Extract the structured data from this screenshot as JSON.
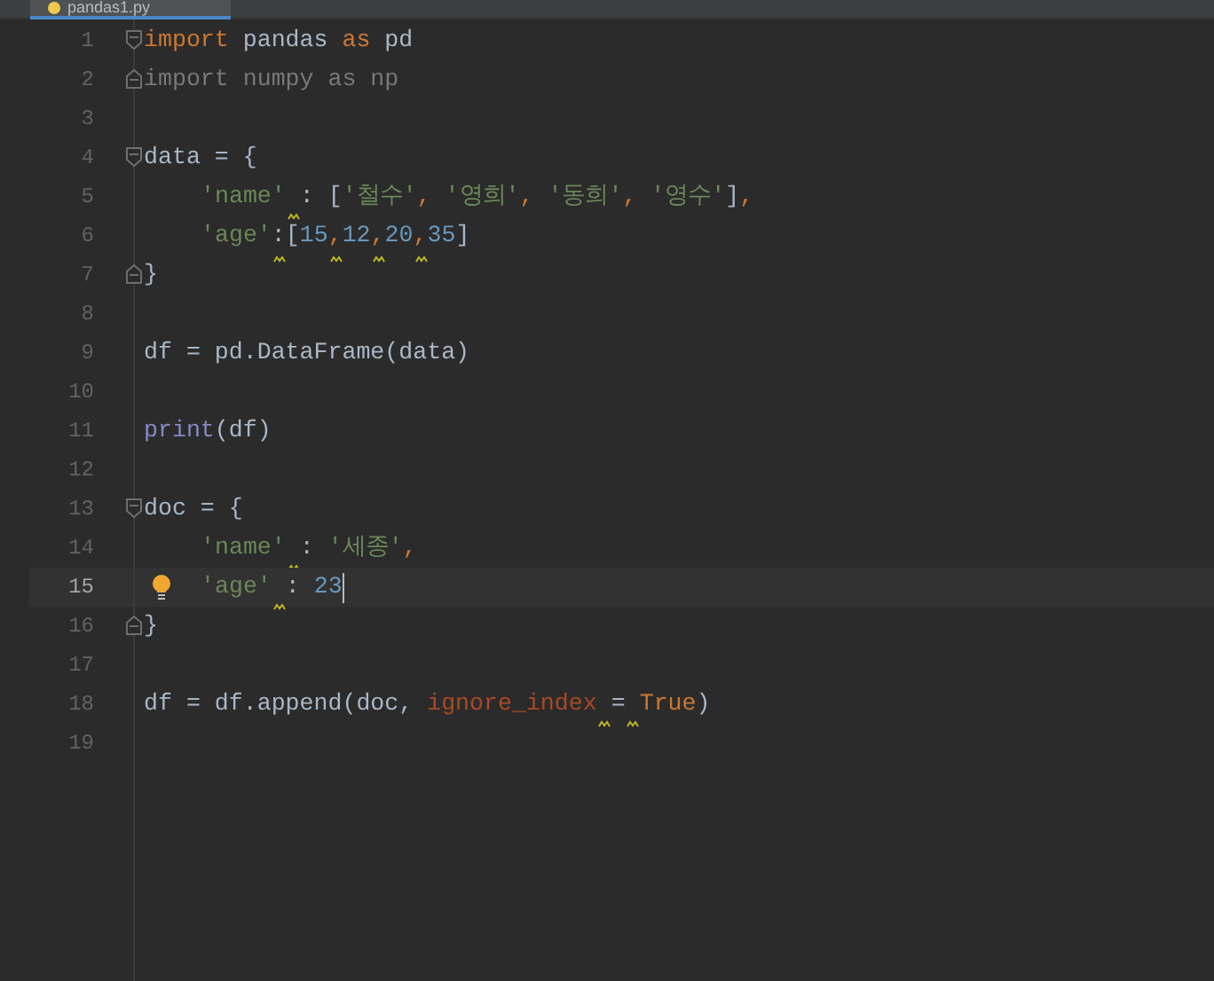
{
  "tab": {
    "label": "pandas1.py",
    "selected": true
  },
  "lines": [
    {
      "number": "1",
      "fold_start": true,
      "current": false,
      "tokens": [
        {
          "kind": "keyword",
          "text": "import"
        },
        {
          "kind": "plain",
          "text": " pandas "
        },
        {
          "kind": "keyword",
          "text": "as"
        },
        {
          "kind": "plain",
          "text": " pd"
        }
      ]
    },
    {
      "number": "2",
      "fold_end": true,
      "current": false,
      "tokens": [
        {
          "kind": "unused",
          "text": "import numpy as np"
        }
      ]
    },
    {
      "number": "3",
      "current": false
    },
    {
      "number": "4",
      "fold_start": true,
      "current": false,
      "tokens": [
        {
          "kind": "plain",
          "text": "data = {"
        }
      ]
    },
    {
      "number": "5",
      "indent": true,
      "current": false,
      "tokens": [
        {
          "kind": "string",
          "text": "'name'"
        },
        {
          "kind": "gap",
          "warn": true
        },
        {
          "kind": "plain",
          "text": ": ["
        },
        {
          "kind": "string",
          "text": "'철수'"
        },
        {
          "kind": "keyword",
          "text": ", "
        },
        {
          "kind": "string",
          "text": "'영희'"
        },
        {
          "kind": "keyword",
          "text": ", "
        },
        {
          "kind": "string",
          "text": "'동희'"
        },
        {
          "kind": "keyword",
          "text": ", "
        },
        {
          "kind": "string",
          "text": "'영수'"
        },
        {
          "kind": "plain",
          "text": "]"
        },
        {
          "kind": "keyword",
          "text": ","
        }
      ]
    },
    {
      "number": "6",
      "indent": true,
      "current": false,
      "tokens": [
        {
          "kind": "string",
          "text": "'age'"
        },
        {
          "kind": "plain",
          "text": ":",
          "warn": true
        },
        {
          "kind": "plain",
          "text": "["
        },
        {
          "kind": "number",
          "text": "15"
        },
        {
          "kind": "keyword",
          "text": ",",
          "warn": true
        },
        {
          "kind": "number",
          "text": "12"
        },
        {
          "kind": "keyword",
          "text": ",",
          "warn": true
        },
        {
          "kind": "number",
          "text": "20"
        },
        {
          "kind": "keyword",
          "text": ",",
          "warn": true
        },
        {
          "kind": "number",
          "text": "35"
        },
        {
          "kind": "plain",
          "text": "]"
        }
      ]
    },
    {
      "number": "7",
      "fold_end": true,
      "current": false,
      "tokens": [
        {
          "kind": "plain",
          "text": "}"
        }
      ]
    },
    {
      "number": "8",
      "current": false
    },
    {
      "number": "9",
      "current": false,
      "tokens": [
        {
          "kind": "plain",
          "text": "df = pd.DataFrame(data)"
        }
      ]
    },
    {
      "number": "10",
      "current": false
    },
    {
      "number": "11",
      "current": false,
      "tokens": [
        {
          "kind": "builtin",
          "text": "print"
        },
        {
          "kind": "plain",
          "text": "(df)"
        }
      ]
    },
    {
      "number": "12",
      "current": false
    },
    {
      "number": "13",
      "fold_start": true,
      "current": false,
      "tokens": [
        {
          "kind": "plain",
          "text": "doc = {"
        }
      ]
    },
    {
      "number": "14",
      "indent": true,
      "current": false,
      "tokens": [
        {
          "kind": "string",
          "text": "'name'"
        },
        {
          "kind": "gap",
          "warn": true
        },
        {
          "kind": "plain",
          "text": ": "
        },
        {
          "kind": "string",
          "text": "'세종'"
        },
        {
          "kind": "keyword",
          "text": ","
        }
      ]
    },
    {
      "number": "15",
      "indent": true,
      "current": true,
      "bulb": true,
      "caret": true,
      "tokens": [
        {
          "kind": "string",
          "text": "'age'"
        },
        {
          "kind": "gap",
          "warn": true
        },
        {
          "kind": "plain",
          "text": ": "
        },
        {
          "kind": "number",
          "text": "23"
        }
      ]
    },
    {
      "number": "16",
      "fold_end": true,
      "current": false,
      "tokens": [
        {
          "kind": "plain",
          "text": "}"
        }
      ]
    },
    {
      "number": "17",
      "current": false
    },
    {
      "number": "18",
      "current": false,
      "tokens": [
        {
          "kind": "plain",
          "text": "df = df.append(doc, "
        },
        {
          "kind": "param",
          "text": "ignore_index"
        },
        {
          "kind": "gap",
          "warn": true
        },
        {
          "kind": "plain",
          "text": "="
        },
        {
          "kind": "gap",
          "warn": true
        },
        {
          "kind": "keyword",
          "text": "True"
        },
        {
          "kind": "plain",
          "text": ")"
        }
      ]
    },
    {
      "number": "19",
      "current": false
    }
  ]
}
